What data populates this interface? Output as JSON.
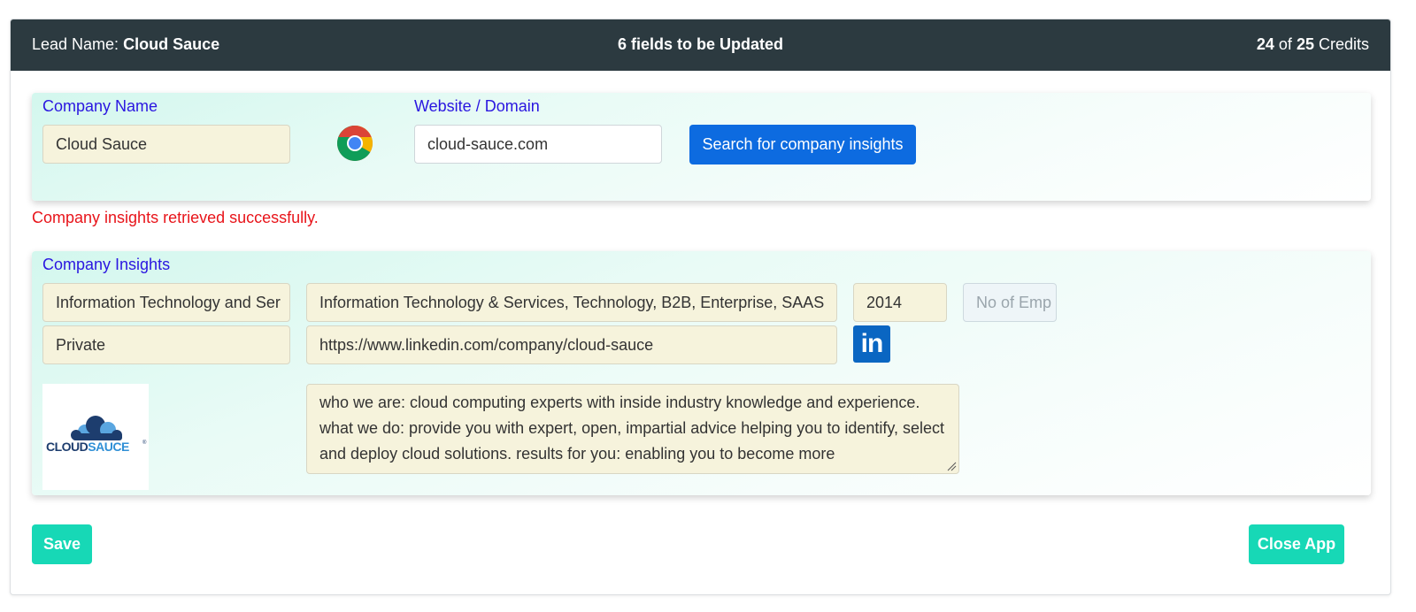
{
  "header": {
    "lead_prefix": "Lead Name:",
    "lead_name": "Cloud Sauce",
    "fields_to_update": "6 fields to be Updated",
    "credits_used": "24",
    "credits_of": "of",
    "credits_total": "25",
    "credits_suffix": "Credits"
  },
  "company_search": {
    "company_name_label": "Company Name",
    "company_name_value": "Cloud Sauce",
    "website_label": "Website / Domain",
    "website_value": "cloud-sauce.com",
    "search_button": "Search for company insights",
    "browser_icon": "chrome-icon"
  },
  "status_message": "Company insights retrieved successfully.",
  "insights": {
    "label": "Company Insights",
    "industry": "Information Technology and Ser",
    "keywords": "Information Technology & Services, Technology, B2B, Enterprise, SAAS",
    "founded_year": "2014",
    "employees_placeholder": "No of Emp",
    "ownership": "Private",
    "linkedin_url": "https://www.linkedin.com/company/cloud-sauce",
    "linkedin_icon_text": "in",
    "logo_text": "CLOUDSAUCE",
    "logo_mark": "®",
    "description": "who we are: cloud computing experts with inside industry knowledge and experience. what we do: provide you with expert, open, impartial advice helping you to identify, select and deploy cloud solutions. results for you: enabling you to become more"
  },
  "footer": {
    "save_button": "Save",
    "close_button": "Close App"
  },
  "colors": {
    "header_bg": "#2c3a40",
    "label_color": "#2a16e0",
    "search_button": "#0d6be0",
    "status_error_red": "#e8141a",
    "action_buttons": "#17d8b6",
    "linkedin_blue": "#0a66c2",
    "field_bg": "#f6f3dc"
  }
}
